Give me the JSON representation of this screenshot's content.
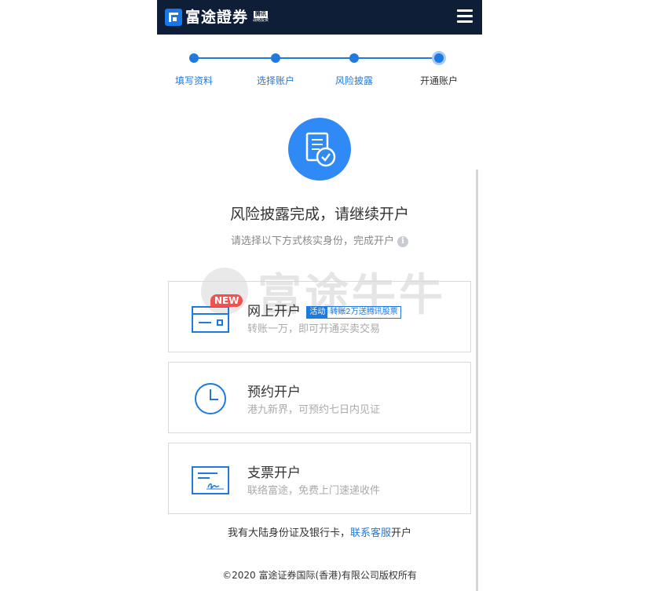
{
  "header": {
    "logo_text": "富途證券",
    "logo_badge_top": "腾讯",
    "logo_badge_bottom": "战略投资",
    "menu_icon": "hamburger-menu-icon"
  },
  "steps": [
    {
      "label": "填写资料",
      "state": "done"
    },
    {
      "label": "选择账户",
      "state": "done"
    },
    {
      "label": "风险披露",
      "state": "done"
    },
    {
      "label": "开通账户",
      "state": "current"
    }
  ],
  "hero": {
    "icon": "document-check-icon",
    "title": "风险披露完成，请继续开户",
    "subtitle": "请选择以下方式核实身份，完成开户",
    "info_icon": "i"
  },
  "watermark": {
    "text": "富途牛牛"
  },
  "options": [
    {
      "title": "网上开户",
      "desc": "转账一万，即可开通买卖交易",
      "badge": "NEW",
      "tag_label": "活动",
      "tag_text": "转账2万送腾讯股票",
      "icon": "bank-card-icon"
    },
    {
      "title": "预约开户",
      "desc": "港九新界，可预约七日内见证",
      "icon": "clock-icon"
    },
    {
      "title": "支票开户",
      "desc": "联络富途，免费上门速递收件",
      "icon": "cheque-icon"
    }
  ],
  "footer": {
    "contact_prefix": "我有大陆身份证及银行卡，",
    "contact_link": "联系客服",
    "contact_suffix": "开户",
    "copyright": "©2020 富途证券国际(香港)有限公司版权所有"
  },
  "colors": {
    "header_bg": "#0e1e36",
    "accent": "#1f7ae0",
    "badge_red": "#f2514e"
  }
}
